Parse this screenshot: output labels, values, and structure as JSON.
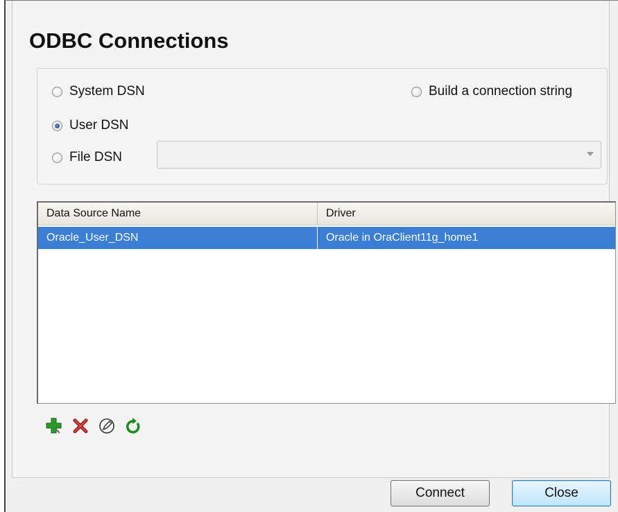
{
  "dialog": {
    "title": "ODBC Connections"
  },
  "options": {
    "system_dsn": "System DSN",
    "user_dsn": "User DSN",
    "file_dsn": "File DSN",
    "build_connection_string": "Build a connection string",
    "selected": "User DSN",
    "file_dsn_value": ""
  },
  "table": {
    "columns": [
      "Data Source Name",
      "Driver"
    ],
    "rows": [
      {
        "name": "Oracle_User_DSN",
        "driver": "Oracle in OraClient11g_home1",
        "selected": true
      }
    ]
  },
  "toolbar": {
    "icons": [
      "add-icon",
      "delete-icon",
      "edit-icon",
      "refresh-icon"
    ]
  },
  "buttons": {
    "connect": "Connect",
    "close": "Close"
  },
  "colors": {
    "selection": "#3a7fd5",
    "add_icon": "#2a9a2a",
    "delete_icon": "#a01c1c",
    "refresh_icon": "#1e8a1e",
    "close_button_border": "#3c7fb1"
  }
}
